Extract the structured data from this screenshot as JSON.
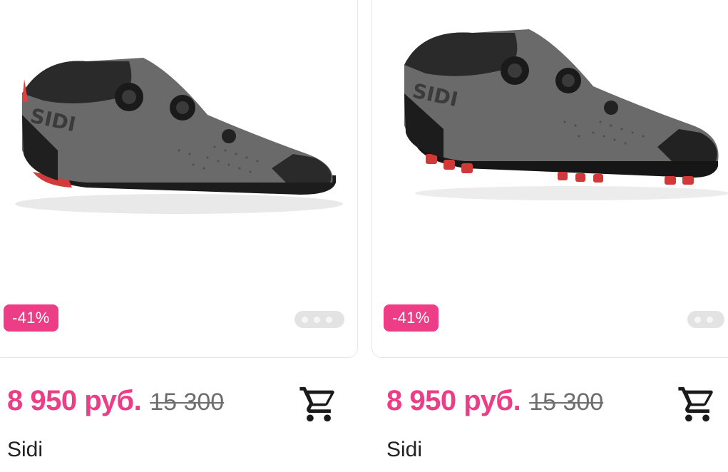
{
  "products": [
    {
      "brand": "Sidi",
      "discount_badge": "-41%",
      "price": "8 950 руб.",
      "old_price": "15 300",
      "image_icon": "road-cycling-shoe",
      "carousel_dots": 3
    },
    {
      "brand": "Sidi",
      "discount_badge": "-41%",
      "price": "8 950 руб.",
      "old_price": "15 300",
      "image_icon": "mtb-cycling-shoe",
      "carousel_dots": 2
    }
  ],
  "colors": {
    "accent": "#ec3d86",
    "old_price": "#6e6e6e",
    "text": "#222222"
  },
  "icons": {
    "cart": "cart-icon"
  }
}
